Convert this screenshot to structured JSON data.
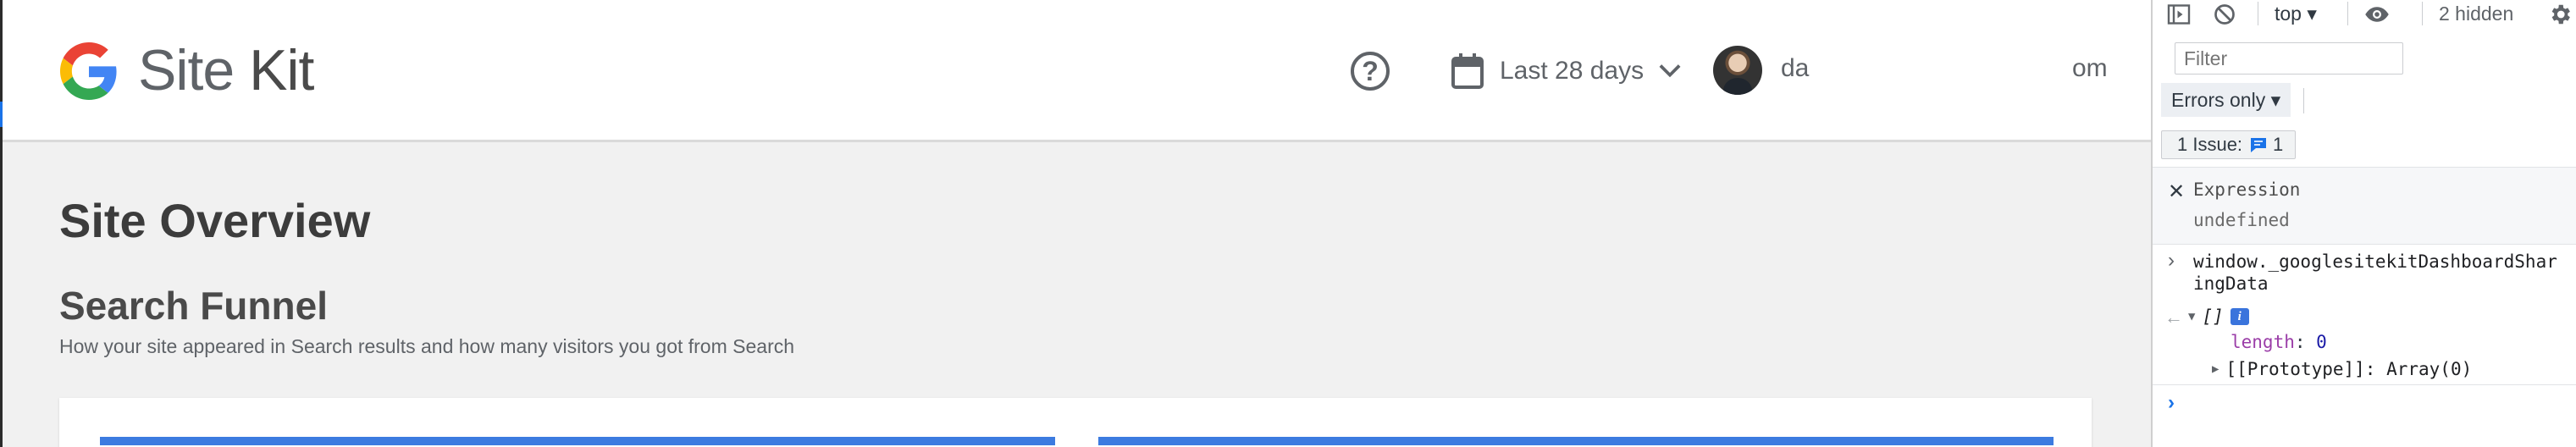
{
  "sitekit": {
    "brand_primary": "Site",
    "brand_secondary": " Kit",
    "help_label": "?",
    "date_range": "Last 28 days",
    "user_prefix": "da",
    "user_suffix": "om",
    "page_title": "Site Overview",
    "section_title": "Search Funnel",
    "section_description": "How your site appeared in Search results and how many visitors you got from Search"
  },
  "devtools": {
    "context": "top ▾",
    "hidden_count": "2 hidden",
    "filter_placeholder": "Filter",
    "levels": "Errors only ▾",
    "issues_label": "1 Issue:",
    "issues_count": "1",
    "expression_label": "Expression",
    "expression_value": "undefined",
    "input_command": "window._googlesitekitDashboardSharingData",
    "result_array": "[]",
    "info_badge": "i",
    "length_key": "length",
    "length_value": "0",
    "prototype_line": "[[Prototype]]: Array(0)"
  },
  "colors": {
    "brand_blue": "#4285F4",
    "brand_red": "#EA4335",
    "brand_yellow": "#FBBC05",
    "brand_green": "#34A853",
    "bar_blue": "#3c7be0"
  }
}
